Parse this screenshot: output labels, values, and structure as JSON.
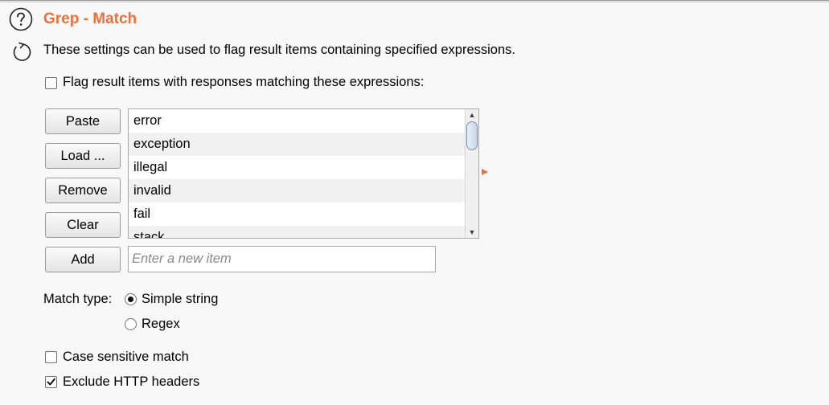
{
  "section": {
    "title": "Grep - Match",
    "description": "These settings can be used to flag result items containing specified expressions."
  },
  "flag_checkbox": {
    "label": "Flag result items with responses matching these expressions:",
    "checked": false
  },
  "buttons": {
    "paste": "Paste",
    "load": "Load ...",
    "remove": "Remove",
    "clear": "Clear",
    "add": "Add"
  },
  "list": {
    "items": [
      "error",
      "exception",
      "illegal",
      "invalid",
      "fail",
      "stack"
    ]
  },
  "new_item": {
    "placeholder": "Enter a new item",
    "value": ""
  },
  "match_type": {
    "label": "Match type:",
    "options": [
      {
        "label": "Simple string",
        "selected": true
      },
      {
        "label": "Regex",
        "selected": false
      }
    ]
  },
  "options": {
    "case_sensitive": {
      "label": "Case sensitive match",
      "checked": false
    },
    "exclude_headers": {
      "label": "Exclude HTTP headers",
      "checked": true
    }
  },
  "colors": {
    "accent": "#ee6f3a",
    "background": "#f8f8f8"
  },
  "icons": {
    "help": "help-icon",
    "refresh": "refresh-icon",
    "marker": "arrow-marker-icon"
  }
}
